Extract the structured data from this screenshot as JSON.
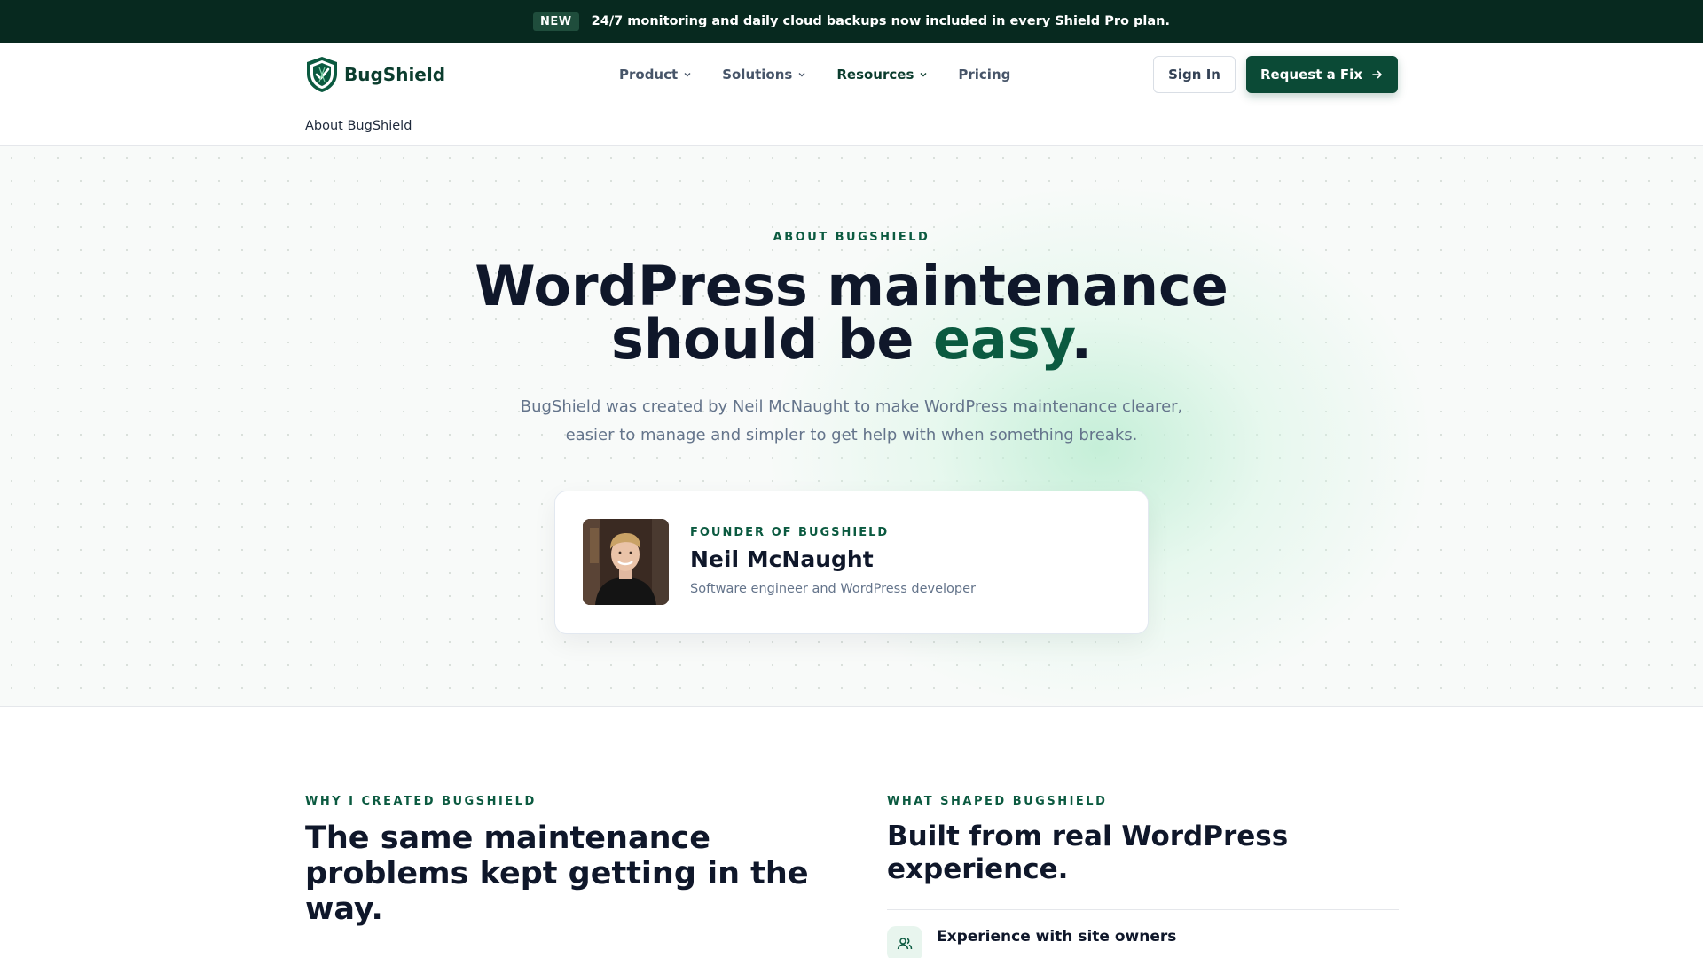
{
  "announcement": {
    "badge": "NEW",
    "message": "24/7 monitoring and daily cloud backups now included in every Shield Pro plan."
  },
  "header": {
    "brand": "BugShield",
    "nav": [
      {
        "label": "Product",
        "dropdown": true
      },
      {
        "label": "Solutions",
        "dropdown": true
      },
      {
        "label": "Resources",
        "dropdown": true,
        "active": true
      },
      {
        "label": "Pricing",
        "dropdown": false
      }
    ],
    "sign_in": "Sign In",
    "cta": "Request a Fix"
  },
  "breadcrumb": "About BugShield",
  "hero": {
    "eyebrow": "ABOUT BUGSHIELD",
    "title_line1": "WordPress maintenance",
    "title_line2_pre": "should be ",
    "title_accent": "easy",
    "title_end": ".",
    "lede": "BugShield was created by Neil McNaught to make WordPress maintenance clearer, easier to manage and simpler to get help with when something breaks."
  },
  "founder": {
    "role": "FOUNDER OF BUGSHIELD",
    "name": "Neil McNaught",
    "description": "Software engineer and WordPress developer"
  },
  "why": {
    "kicker": "WHY I CREATED BUGSHIELD",
    "heading": "The same maintenance problems kept getting in the way."
  },
  "shaped": {
    "kicker": "WHAT SHAPED BUGSHIELD",
    "heading": "Built from real WordPress experience.",
    "items": [
      {
        "title": "Experience with site owners",
        "icon": "users-icon"
      }
    ]
  },
  "colors": {
    "brand_dark": "#07291f",
    "brand_green": "#0b4a36",
    "accent_green": "#0b5a40",
    "muted_text": "#64748b"
  }
}
